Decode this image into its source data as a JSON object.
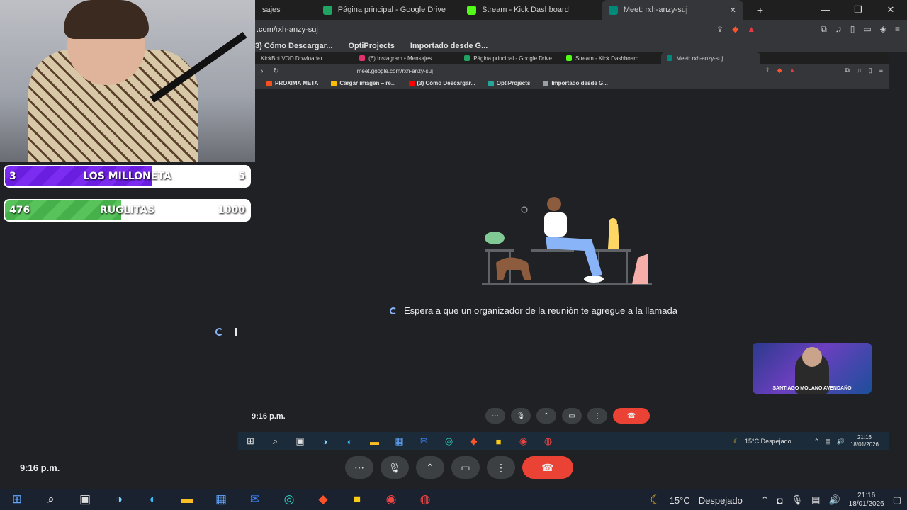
{
  "outer_browser": {
    "tabs": [
      {
        "label": "sajes",
        "color": "#e1306c"
      },
      {
        "label": "Página principal - Google Drive",
        "color": "#1fa463"
      },
      {
        "label": "Stream - Kick Dashboard",
        "color": "#53fc18"
      },
      {
        "label": "Meet: rxh-anzy-suj",
        "color": "#00897b",
        "active": true
      }
    ],
    "close_glyph": "✕",
    "new_tab_glyph": "+",
    "window_controls": [
      "—",
      "❐",
      "✕"
    ],
    "url": ".com/rxh-anzy-suj",
    "bookmarks": [
      "3) Cómo Descargar...",
      "OptiProjects",
      "Importado desde G..."
    ]
  },
  "inner_browser": {
    "tabs": [
      {
        "label": "KickBot VOD Dowloader",
        "color": "#53fc18"
      },
      {
        "label": "(6) Instagram • Mensajes",
        "color": "#e1306c"
      },
      {
        "label": "Página principal - Google Drive",
        "color": "#1fa463"
      },
      {
        "label": "Stream - Kick Dashboard",
        "color": "#53fc18"
      },
      {
        "label": "Meet: rxh-anzy-suj",
        "color": "#00897b",
        "active": true
      }
    ],
    "url": "meet.google.com/rxh-anzy-suj",
    "bookmarks": [
      {
        "label": "PROXIMA META",
        "color": "#f4511e"
      },
      {
        "label": "Cargar imagen – re...",
        "color": "#fbbc04"
      },
      {
        "label": "(3) Cómo Descargar...",
        "color": "#ff0000"
      },
      {
        "label": "OptiProjects",
        "color": "#26a69a"
      },
      {
        "label": "Importado desde G...",
        "color": "#9aa0a6"
      }
    ]
  },
  "meet": {
    "waiting_message": "Espera a que un organizador de la reunión te agregue a la llamada",
    "self_view_name": "SANTIAGO MOLANO AVENDAÑO",
    "inner_time": "9:16 p.m.",
    "outer_time": "9:16 p.m.",
    "controls": [
      "more-options",
      "microphone",
      "chevron-up",
      "camera",
      "menu",
      "end-call"
    ]
  },
  "overlay": {
    "goal1": {
      "current": "3",
      "label": "LOS MILLONETA",
      "target": "5",
      "progress": 0.6
    },
    "goal2": {
      "current": "476",
      "label": "RUGLITAS",
      "target": "1000",
      "progress": 0.476
    }
  },
  "taskbar": {
    "weather_temp": "15°C",
    "weather_text": "Despejado",
    "time": "21:16",
    "date": "18/01/2026",
    "inner_weather": "15°C  Despejado",
    "inner_time": "21:16",
    "inner_date": "18/01/2026"
  },
  "colors": {
    "end_call": "#ea4335",
    "goal1": "#7b2cf0",
    "goal2": "#58c35a",
    "background": "#202124"
  }
}
